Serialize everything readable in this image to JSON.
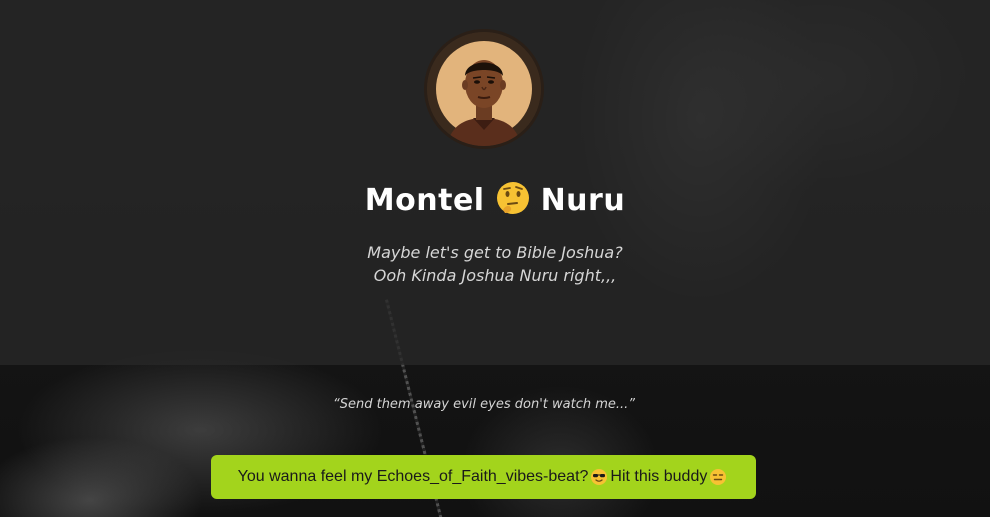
{
  "profile": {
    "name_first": "Montel",
    "name_emoji": "thinking-face-emoji",
    "name_last": "Nuru",
    "bio_line1": "Maybe let's get to Bible Joshua?",
    "bio_line2": "Ooh Kinda Joshua Nuru right,,,"
  },
  "quote": {
    "text": "“Send them away evil eyes don't watch me...”"
  },
  "links": [
    {
      "label_part1": "You wanna feel my Echoes_of_Faith_vibes-beat?",
      "icon1": "sunglasses-face-emoji",
      "label_part2": " Hit this buddy",
      "icon2": "expressionless-face-emoji"
    }
  ],
  "colors": {
    "accent": "#a3d41c",
    "header_overlay": "#282828",
    "background": "#0b0b0b"
  }
}
